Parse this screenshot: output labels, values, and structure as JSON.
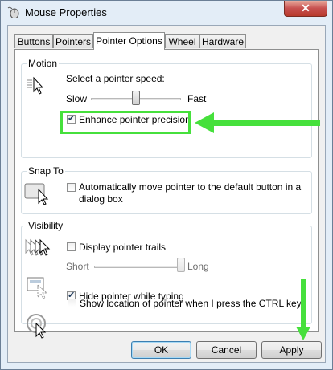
{
  "window": {
    "title": "Mouse Properties",
    "close_glyph": "✕"
  },
  "tabs": [
    {
      "label": "Buttons"
    },
    {
      "label": "Pointers"
    },
    {
      "label": "Pointer Options"
    },
    {
      "label": "Wheel"
    },
    {
      "label": "Hardware"
    }
  ],
  "active_tab": "Pointer Options",
  "motion": {
    "group_label": "Motion",
    "speed_label": "Select a pointer speed:",
    "slow_label": "Slow",
    "fast_label": "Fast",
    "speed_level": 0.5,
    "enhance_precision_label": "Enhance pointer precision",
    "enhance_precision_checked": true
  },
  "snap_to": {
    "group_label": "Snap To",
    "option_label_line1": "Automatically move pointer to the default button in a",
    "option_label_line2": "dialog box",
    "checked": false
  },
  "visibility": {
    "group_label": "Visibility",
    "trails_label": "Display pointer trails",
    "trails_checked": false,
    "short_label": "Short",
    "long_label": "Long",
    "trail_length_level": 1.0,
    "hide_label": "Hide pointer while typing",
    "hide_checked": true,
    "ctrl_label": "Show location of pointer when I press the CTRL key",
    "ctrl_checked": false
  },
  "buttons": {
    "ok": "OK",
    "cancel": "Cancel",
    "apply": "Apply"
  },
  "check_glyph": "✔",
  "icons": [
    "mouse-properties-icon",
    "pointer-speed-icon",
    "snap-to-icon",
    "pointer-trails-icon",
    "hide-pointer-icon",
    "ctrl-locate-icon"
  ],
  "colors": {
    "annotation": "#46e03c",
    "window_frame": "#e3edf7",
    "close_button": "#c75050"
  }
}
